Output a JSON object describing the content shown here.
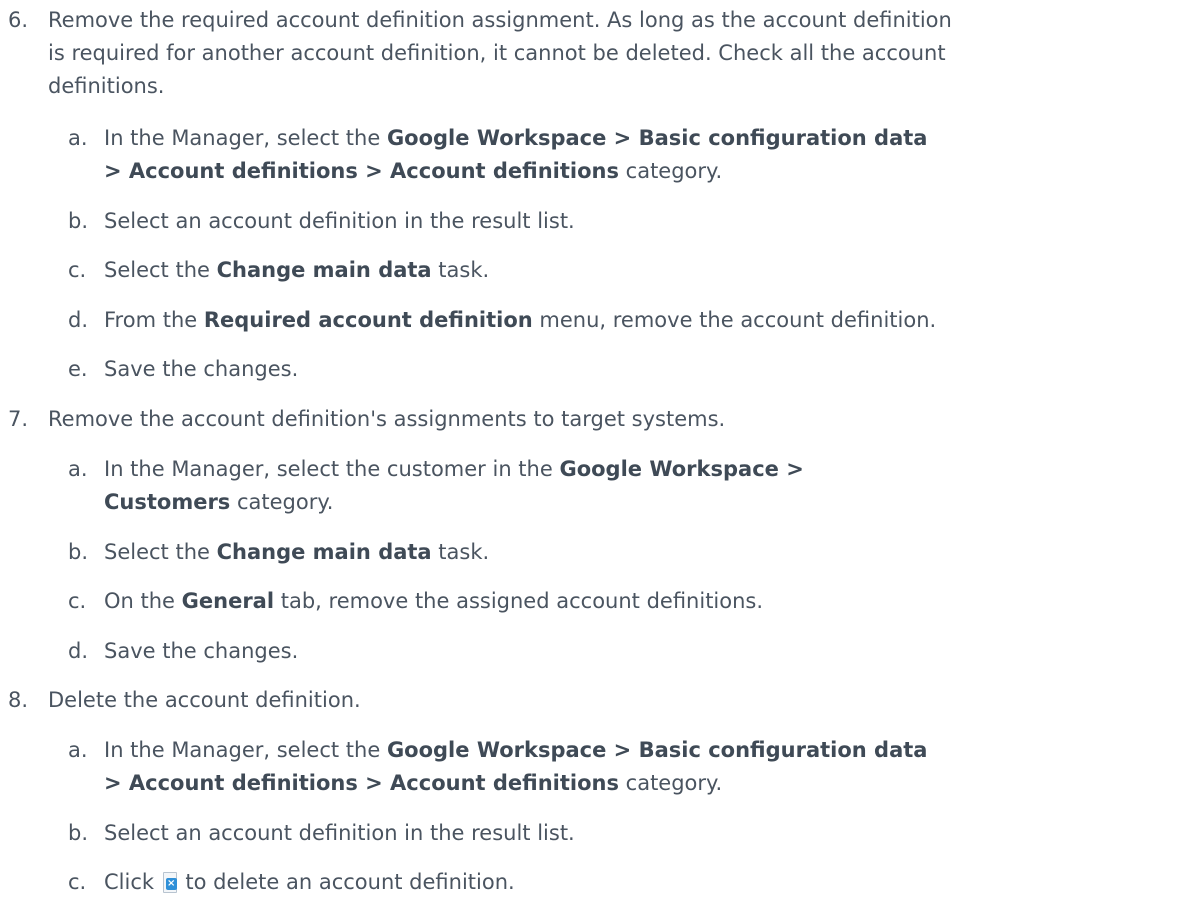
{
  "steps": [
    {
      "num": "6.",
      "text_lines": [
        "Remove the required account definition assignment. As long as the account definition",
        "is required for another account definition, it cannot be deleted. Check all the account",
        "definitions."
      ],
      "substeps": [
        {
          "letter": "a.",
          "line1": {
            "pre": "In the Manager, select the ",
            "bold": "Google Workspace > Basic configuration data"
          },
          "line2": {
            "bold": "> Account definitions > Account definitions",
            "post": " category."
          }
        },
        {
          "letter": "b.",
          "text": "Select an account definition in the result list."
        },
        {
          "letter": "c.",
          "pre": "Select the ",
          "bold": "Change main data",
          "post": " task."
        },
        {
          "letter": "d.",
          "pre": "From the ",
          "bold": "Required account definition",
          "post": " menu, remove the account definition."
        },
        {
          "letter": "e.",
          "text": "Save the changes."
        }
      ]
    },
    {
      "num": "7.",
      "text": "Remove the account definition's assignments to target systems.",
      "substeps": [
        {
          "letter": "a.",
          "line1": {
            "pre": "In the Manager, select the customer in the ",
            "bold": "Google Workspace >"
          },
          "line2": {
            "bold": "Customers",
            "post": " category."
          }
        },
        {
          "letter": "b.",
          "pre": "Select the ",
          "bold": "Change main data",
          "post": " task."
        },
        {
          "letter": "c.",
          "pre": "On the ",
          "bold": "General",
          "post": " tab, remove the assigned account definitions."
        },
        {
          "letter": "d.",
          "text": "Save the changes."
        }
      ]
    },
    {
      "num": "8.",
      "text": "Delete the account definition.",
      "substeps": [
        {
          "letter": "a.",
          "line1": {
            "pre": "In the Manager, select the ",
            "bold": "Google Workspace > Basic configuration data"
          },
          "line2": {
            "bold": "> Account definitions > Account definitions",
            "post": " category."
          }
        },
        {
          "letter": "b.",
          "text": "Select an account definition in the result list."
        },
        {
          "letter": "c.",
          "pre": "Click ",
          "icon": "delete-icon",
          "post": " to delete an account definition."
        }
      ]
    }
  ]
}
